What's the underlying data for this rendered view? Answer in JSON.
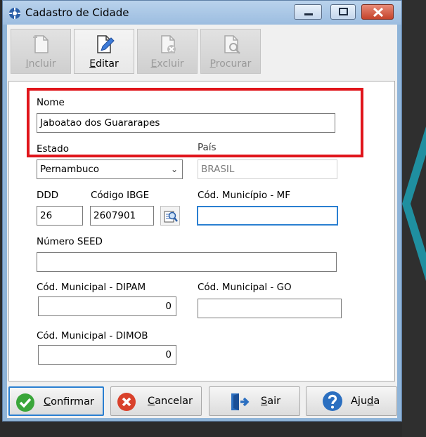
{
  "window": {
    "title": "Cadastro de Cidade"
  },
  "toolbar": {
    "buttons": [
      {
        "label": "Incluir",
        "ul": "I",
        "rest": "ncluir",
        "enabled": false
      },
      {
        "label": "Editar",
        "ul": "E",
        "rest": "ditar",
        "enabled": true
      },
      {
        "label": "Excluir",
        "ul": "E",
        "rest": "xcluir",
        "enabled": false
      },
      {
        "label": "Procurar",
        "ul": "P",
        "rest": "rocurar",
        "enabled": false
      }
    ]
  },
  "form": {
    "nome_label": "Nome",
    "nome_value": "Jaboatao dos Guararapes",
    "estado_label": "Estado",
    "estado_value": "Pernambuco",
    "pais_label": "País",
    "pais_value": "BRASIL",
    "ddd_label": "DDD",
    "ddd_value": "26",
    "ibge_label": "Código IBGE",
    "ibge_value": "2607901",
    "mf_label": "Cód. Município - MF",
    "mf_value": "",
    "seed_label": "Número SEED",
    "seed_value": "",
    "dipam_label": "Cód. Municipal - DIPAM",
    "dipam_value": "0",
    "go_label": "Cód. Municipal - GO",
    "go_value": "",
    "dimob_label": "Cód. Municipal - DIMOB",
    "dimob_value": "0"
  },
  "buttons": {
    "confirmar": {
      "ul": "C",
      "rest": "onfirmar"
    },
    "cancelar": {
      "ul": "C",
      "rest": "ancelar"
    },
    "sair": {
      "ul": "S",
      "rest": "air"
    },
    "ajuda": {
      "pre": "Aju",
      "ul": "d",
      "rest": "a"
    }
  },
  "colors": {
    "highlight": "#e0151b",
    "focus": "#2a7fd1",
    "confirm_green": "#3aa63a",
    "cancel_red": "#d9412b",
    "help_blue": "#2b6fc0",
    "accent_teal": "#1f8fa0"
  },
  "icons": {
    "title": "app-icon",
    "incluir": "new-document-icon",
    "editar": "edit-document-icon",
    "excluir": "delete-document-icon",
    "procurar": "search-document-icon",
    "lookup": "lookup-icon",
    "confirmar": "checkmark-icon",
    "cancelar": "cancel-icon",
    "sair": "exit-icon",
    "ajuda": "help-icon"
  }
}
